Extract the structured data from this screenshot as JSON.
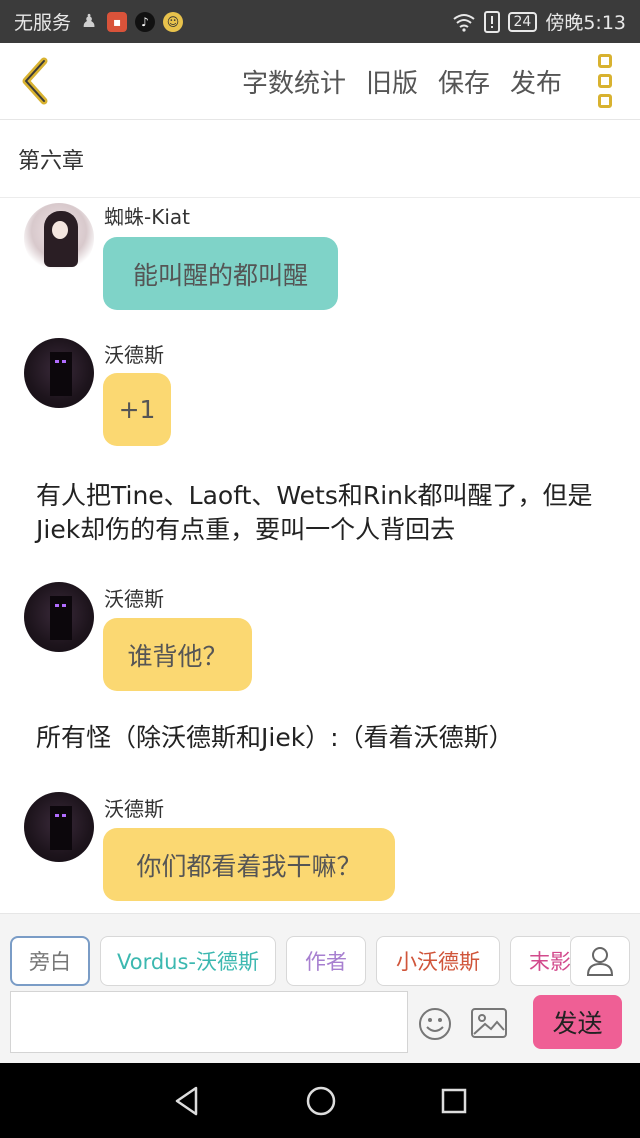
{
  "status_bar": {
    "carrier": "无服务",
    "icons": [
      "person-icon",
      "ting-app-icon",
      "tiktok-icon",
      "face-app-icon"
    ],
    "battery": "24",
    "time": "傍晚5:13"
  },
  "toolbar": {
    "back_icon": "chevron-left-icon",
    "word_count": "字数统计",
    "old_version": "旧版",
    "save": "保存",
    "publish": "发布",
    "accent_color": "#d8b230"
  },
  "chapter": {
    "title": "第六章"
  },
  "messages": [
    {
      "type": "bubble",
      "sender": "蜘蛛-Kiat",
      "text": "能叫醒的都叫醒",
      "color": "#7fd3c8"
    },
    {
      "type": "bubble",
      "sender": "沃德斯",
      "text": "+1",
      "color": "#fbd872"
    },
    {
      "type": "narration",
      "text": "有人把Tine、Laoft、Wets和Rink都叫醒了，但是Jiek却伤的有点重，要叫一个人背回去"
    },
    {
      "type": "bubble",
      "sender": "沃德斯",
      "text": "谁背他？",
      "color": "#fbd872"
    },
    {
      "type": "narration",
      "text": "所有怪（除沃德斯和Jiek）:（看着沃德斯）"
    },
    {
      "type": "bubble",
      "sender": "沃德斯",
      "text": "你们都看着我干嘛？",
      "color": "#fbd872"
    }
  ],
  "roles": [
    {
      "label": "旁白"
    },
    {
      "label": "Vordus-沃德斯"
    },
    {
      "label": "作者"
    },
    {
      "label": "小沃德斯"
    },
    {
      "label": "末影"
    }
  ],
  "composer": {
    "input_value": "",
    "send_label": "发送",
    "send_color": "#ef5f95"
  }
}
